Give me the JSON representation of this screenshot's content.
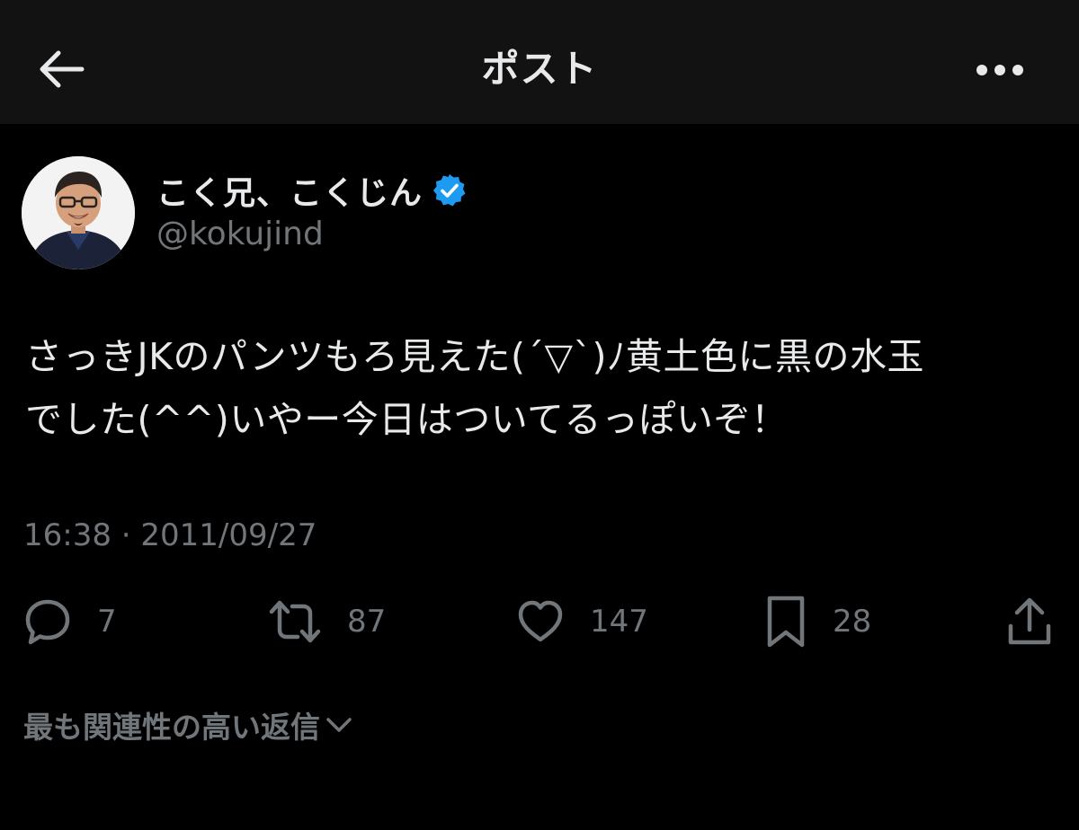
{
  "header": {
    "title": "ポスト",
    "back_icon": "arrow-left-icon",
    "more_icon": "more-horizontal-icon"
  },
  "author": {
    "display_name": "こく兄、こくじん",
    "handle": "@kokujind",
    "verified_icon": "verified-badge-icon",
    "verified_color": "#1d9bf0"
  },
  "post": {
    "text_lines": [
      "さっきJKのパンツもろ見えた(´▽`)ﾉ黄土色に黒の水玉",
      "でした(^^)いやー今日はついてるっぽいぞ！"
    ],
    "timestamp": "16:38 · 2011/09/27"
  },
  "actions": {
    "replies": "7",
    "reposts": "87",
    "likes": "147",
    "bookmarks": "28"
  },
  "replies_sort": {
    "label": "最も関連性の高い返信"
  },
  "colors": {
    "background": "#000000",
    "header_background": "#121212",
    "primary_text": "#e7e9ea",
    "secondary_text": "#71767b",
    "accent": "#1d9bf0"
  }
}
